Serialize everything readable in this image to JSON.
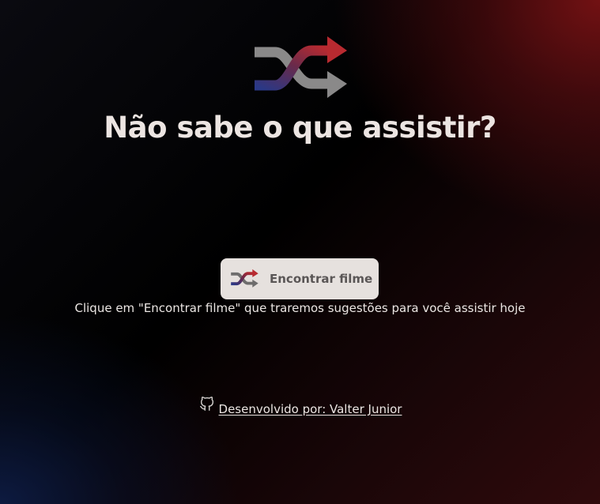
{
  "logo": {
    "icon": "shuffle-icon",
    "colors": {
      "gray": "#8a8989",
      "red": "#b82a30",
      "blue": "#2a3a86"
    }
  },
  "header": {
    "title": "Não sabe o que assistir?"
  },
  "main": {
    "find_button": {
      "label": "Encontrar filme",
      "icon": "shuffle-icon"
    },
    "hint": "Clique em \"Encontrar filme\" que traremos sugestões para você assistir hoje"
  },
  "footer": {
    "icon": "github-icon",
    "text": " Desenvolvido por: Valter Junior"
  }
}
